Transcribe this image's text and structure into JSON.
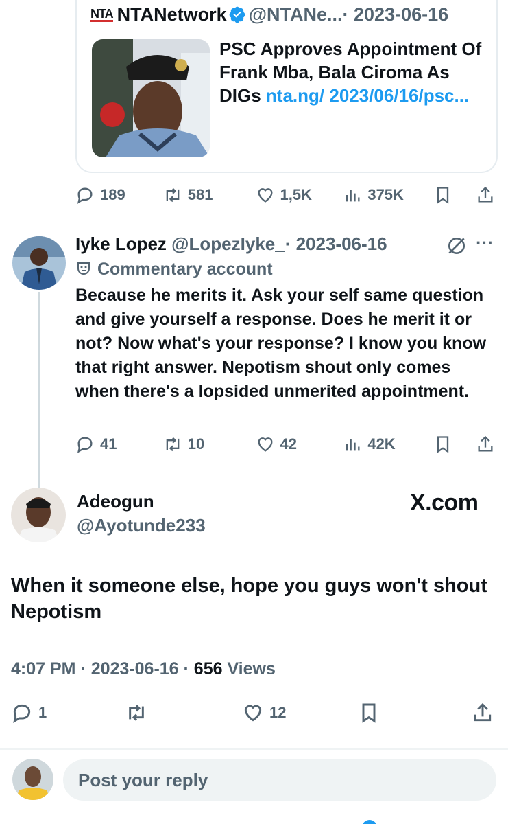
{
  "quoted_tweet": {
    "account_logo": "NTA",
    "name": "NTANetwork",
    "handle": "@NTANe...",
    "date": "· 2023-06-16",
    "verified_icon": "verified-badge-icon",
    "card_title": "PSC Approves Appointment Of Frank Mba, Bala Ciroma As DIGs",
    "card_link": "nta.ng/ 2023/06/16/psc...",
    "stats": {
      "replies": "189",
      "reposts": "581",
      "likes": "1,5K",
      "views": "375K"
    }
  },
  "reply_tweet": {
    "name": "Iyke Lopez",
    "handle": "@LopezIyke_",
    "date": "· 2023-06-16",
    "label": "Commentary account",
    "text": "Because he merits it. Ask your self same question and give yourself a response. Does he merit it or not? Now what's your response? I know you know that right answer. Nepotism shout only comes when there's a lopsided unmerited appointment.",
    "stats": {
      "replies": "41",
      "reposts": "10",
      "likes": "42",
      "views": "42K"
    },
    "more": "···"
  },
  "main_tweet": {
    "name": "Adeogun",
    "handle": "@Ayotunde233",
    "watermark": "X.com",
    "text": "When it someone else, hope you guys won't shout Nepotism",
    "time": "4:07 PM · 2023-06-16 · ",
    "views_count": "656",
    "views_label": " Views",
    "stats": {
      "replies": "1",
      "likes": "12"
    }
  },
  "reply_input": {
    "placeholder": "Post your reply"
  },
  "colors": {
    "accent": "#1d9bf0",
    "muted": "#536471",
    "text": "#0f1419"
  }
}
